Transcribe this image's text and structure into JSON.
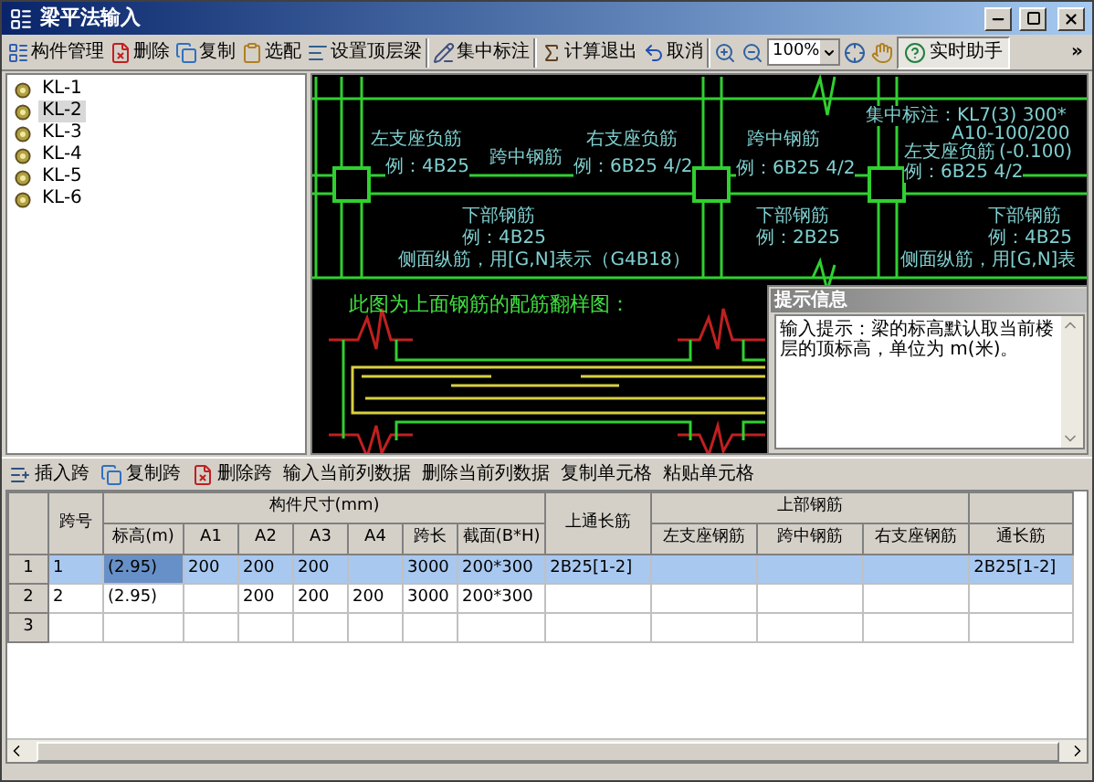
{
  "window": {
    "title": "梁平法输入"
  },
  "toolbar": [
    {
      "kind": "button",
      "label": "构件管理"
    },
    {
      "kind": "button",
      "label": "删除"
    },
    {
      "kind": "button",
      "label": "复制"
    },
    {
      "kind": "button",
      "label": "选配"
    },
    {
      "kind": "button",
      "label": "设置顶层梁"
    },
    {
      "kind": "separator"
    },
    {
      "kind": "button",
      "label": "集中标注"
    },
    {
      "kind": "separator"
    },
    {
      "kind": "button",
      "label": "计算退出"
    },
    {
      "kind": "button",
      "label": "取消"
    },
    {
      "kind": "separator"
    },
    {
      "kind": "icon"
    },
    {
      "kind": "icon"
    },
    {
      "kind": "select",
      "value": "100%"
    },
    {
      "kind": "icon"
    },
    {
      "kind": "icon"
    },
    {
      "kind": "toggle",
      "label": "实时助手",
      "on": true
    },
    {
      "kind": "overflow",
      "label": "»"
    }
  ],
  "tree": {
    "items": [
      {
        "label": "KL-1",
        "selected": false
      },
      {
        "label": "KL-2",
        "selected": true
      },
      {
        "label": "KL-3",
        "selected": false
      },
      {
        "label": "KL-4",
        "selected": false
      },
      {
        "label": "KL-5",
        "selected": false
      },
      {
        "label": "KL-6",
        "selected": false
      }
    ]
  },
  "drawing": {
    "labels": [
      "左支座负筋",
      "例：4B25",
      "跨中钢筋",
      "右支座负筋",
      "例：6B25 4/2",
      "跨中钢筋",
      "例：6B25 4/2",
      "集中标注：KL7(3) 300*",
      "A10-100/200",
      "左支座负筋",
      "(-0.100)",
      "例：6B25 4/2",
      "下部钢筋",
      "例：4B25",
      "侧面纵筋，用[G,N]表示（G4B18）",
      "下部钢筋",
      "例：2B25",
      "下部钢筋",
      "例：4B25",
      "侧面纵筋，用[G,N]表"
    ],
    "caption": "此图为上面钢筋的配筋翻样图："
  },
  "hint_panel": {
    "title": "提示信息",
    "text": "输入提示：梁的标高默认取当前楼层的顶标高，单位为 m(米)。"
  },
  "grid_toolbar": [
    {
      "kind": "button",
      "label": "插入跨"
    },
    {
      "kind": "button",
      "label": "复制跨"
    },
    {
      "kind": "button",
      "label": "删除跨"
    },
    {
      "kind": "text",
      "label": "输入当前列数据"
    },
    {
      "kind": "text",
      "label": "删除当前列数据"
    },
    {
      "kind": "text",
      "label": "复制单元格"
    },
    {
      "kind": "text",
      "label": "粘贴单元格"
    }
  ],
  "table": {
    "groups": [
      {
        "kind": "single",
        "label": "跨号"
      },
      {
        "kind": "group",
        "label": "构件尺寸(mm)"
      },
      {
        "kind": "single",
        "label": "上通长筋"
      },
      {
        "kind": "group",
        "label": "上部钢筋"
      },
      {
        "kind": "group"
      }
    ],
    "columns": [
      "",
      "标高(m)",
      "A1",
      "A2",
      "A3",
      "A4",
      "跨长",
      "截面(B*H)",
      "",
      "左支座钢筋",
      "跨中钢筋",
      "右支座钢筋",
      "通长筋"
    ],
    "rows": [
      {
        "number": "1",
        "selected": true,
        "cells": [
          "1",
          "(2.95)",
          "200",
          "200",
          "200",
          "",
          "3000",
          "200*300",
          "2B25[1-2]",
          "",
          "",
          "",
          "2B25[1-2]"
        ]
      },
      {
        "number": "2",
        "selected": false,
        "cells": [
          "2",
          "(2.95)",
          "",
          "200",
          "200",
          "200",
          "3000",
          "200*300",
          "",
          "",
          "",
          "",
          ""
        ]
      },
      {
        "number": "3",
        "selected": false,
        "cells": [
          "",
          "",
          "",
          "",
          "",
          "",
          "",
          "",
          "",
          "",
          "",
          "",
          ""
        ]
      }
    ]
  }
}
